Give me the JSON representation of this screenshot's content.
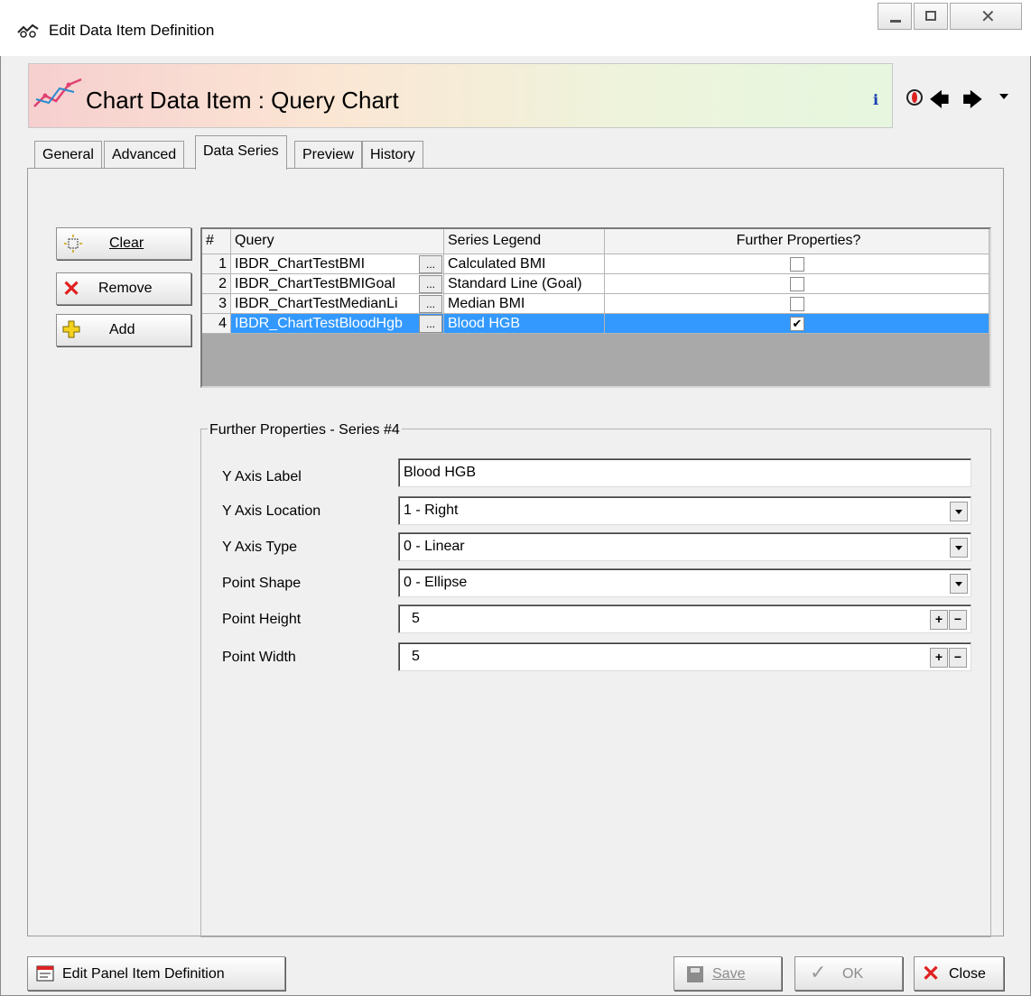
{
  "window": {
    "title": "Edit Data Item Definition",
    "buttons": [
      "minimize",
      "restore",
      "close"
    ]
  },
  "banner": {
    "title": "Chart Data Item : Query Chart",
    "icons": [
      "chart-line-icon",
      "info-icon",
      "alert-icon",
      "back-arrow-icon",
      "forward-arrow-icon",
      "dropdown-arrow-icon"
    ],
    "info_glyph": "i"
  },
  "tabs": [
    {
      "label": "General",
      "active": false
    },
    {
      "label": "Advanced",
      "active": false
    },
    {
      "label": "Data Series",
      "active": true
    },
    {
      "label": "Preview",
      "active": false
    },
    {
      "label": "History",
      "active": false
    }
  ],
  "actions": {
    "clear_label": "Clear",
    "remove_label": "Remove",
    "add_label": "Add"
  },
  "grid": {
    "columns": [
      "#",
      "Query",
      "Series Legend",
      "Further Properties?"
    ],
    "rows": [
      {
        "num": "1",
        "query": "IBDR_ChartTestBMI",
        "legend": "Calculated BMI",
        "further": false,
        "selected": false
      },
      {
        "num": "2",
        "query": "IBDR_ChartTestBMIGoal",
        "legend": "Standard Line (Goal)",
        "further": false,
        "selected": false
      },
      {
        "num": "3",
        "query": "IBDR_ChartTestMedianLi",
        "legend": "Median BMI",
        "further": false,
        "selected": false
      },
      {
        "num": "4",
        "query": "IBDR_ChartTestBloodHgb",
        "legend": "Blood HGB",
        "further": true,
        "selected": true
      }
    ],
    "ellipsis": "..."
  },
  "further_properties": {
    "title": "Further Properties - Series #4",
    "y_axis_label": {
      "label": "Y Axis Label",
      "value": "Blood HGB"
    },
    "y_axis_location": {
      "label": "Y Axis Location",
      "value": "1 - Right"
    },
    "y_axis_type": {
      "label": "Y Axis Type",
      "value": "0 - Linear"
    },
    "point_shape": {
      "label": "Point Shape",
      "value": "0 - Ellipse"
    },
    "point_height": {
      "label": "Point Height",
      "value": "5"
    },
    "point_width": {
      "label": "Point Width",
      "value": "5"
    },
    "plus": "+",
    "minus": "−"
  },
  "footer": {
    "edit_panel_label": "Edit Panel Item Definition",
    "save_label": "Save",
    "ok_label": "OK",
    "close_label": "Close"
  },
  "colors": {
    "selection": "#3399ff",
    "close_red": "#e02020",
    "grid_empty": "#a9a9a9"
  }
}
